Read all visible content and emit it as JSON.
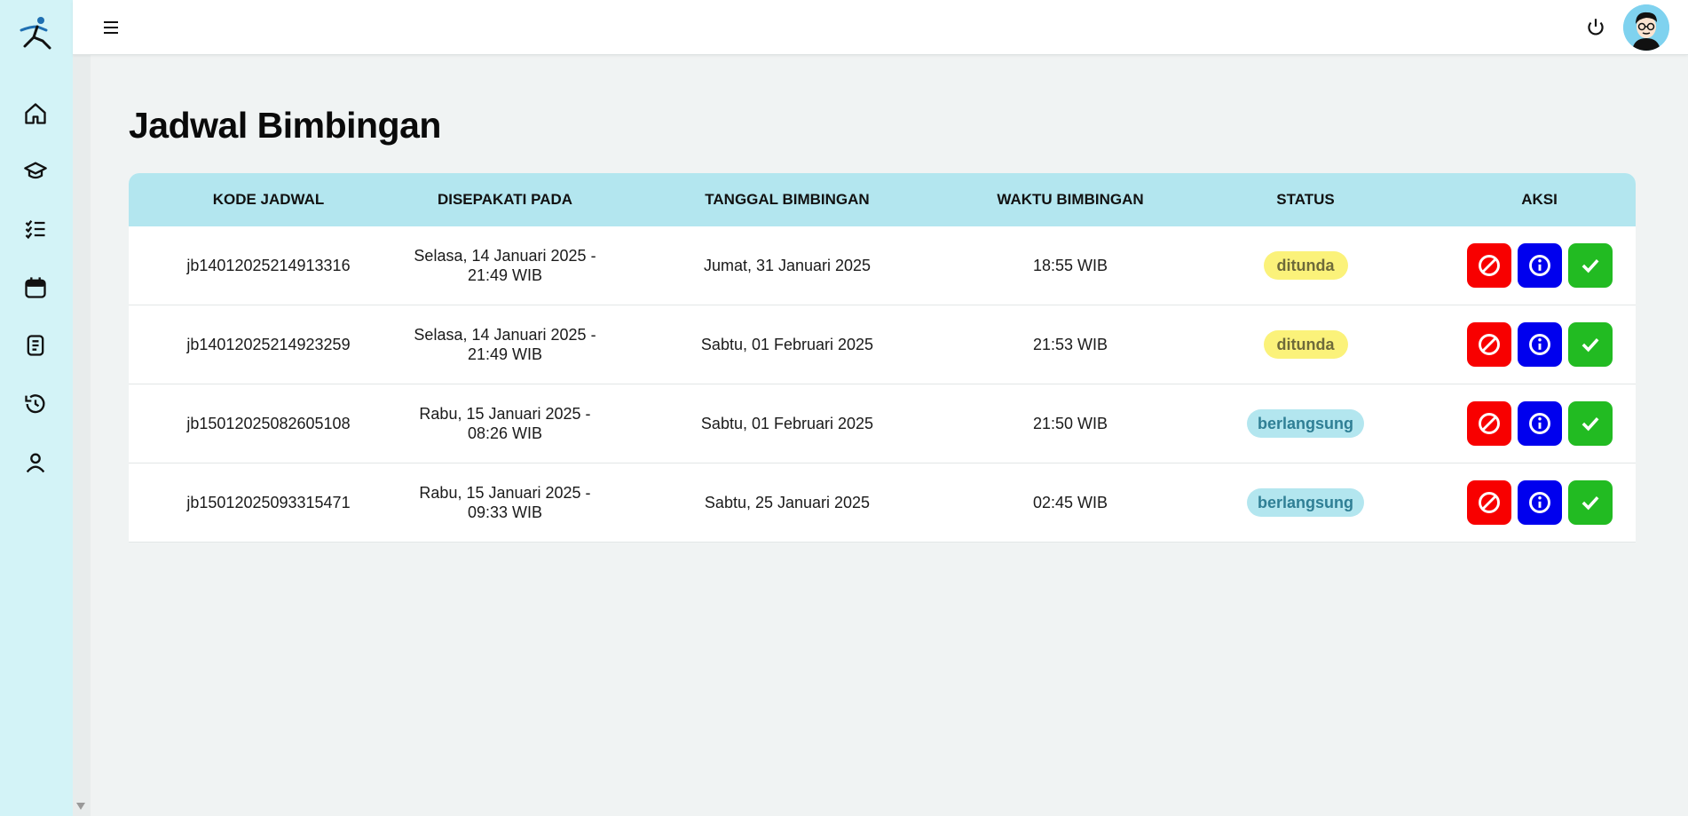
{
  "page": {
    "title": "Jadwal Bimbingan"
  },
  "table": {
    "headers": [
      "KODE JADWAL",
      "DISEPAKATI PADA",
      "TANGGAL BIMBINGAN",
      "WAKTU BIMBINGAN",
      "STATUS",
      "AKSI"
    ],
    "rows": [
      {
        "kode": "jb14012025214913316",
        "disepakati": "Selasa, 14 Januari 2025 - 21:49 WIB",
        "tanggal": "Jumat, 31 Januari 2025",
        "waktu": "18:55 WIB",
        "status": "ditunda"
      },
      {
        "kode": "jb14012025214923259",
        "disepakati": "Selasa, 14 Januari 2025 - 21:49 WIB",
        "tanggal": "Sabtu, 01 Februari 2025",
        "waktu": "21:53 WIB",
        "status": "ditunda"
      },
      {
        "kode": "jb15012025082605108",
        "disepakati": "Rabu, 15 Januari 2025 - 08:26 WIB",
        "tanggal": "Sabtu, 01 Februari 2025",
        "waktu": "21:50 WIB",
        "status": "berlangsung"
      },
      {
        "kode": "jb15012025093315471",
        "disepakati": "Rabu, 15 Januari 2025 - 09:33 WIB",
        "tanggal": "Sabtu, 25 Januari 2025",
        "waktu": "02:45 WIB",
        "status": "berlangsung"
      }
    ]
  },
  "sidebar": {
    "icons": [
      "home-icon",
      "graduation-cap-icon",
      "checklist-icon",
      "calendar-icon",
      "document-icon",
      "history-icon",
      "user-icon"
    ]
  },
  "topbar": {
    "icons": [
      "menu-icon",
      "power-icon",
      "avatar"
    ]
  },
  "colors": {
    "sidebar_bg": "#d3f3f7",
    "table_header_bg": "#b3e6ef",
    "badge_ditunda": "#fbf27a",
    "badge_berlangsung": "#b3e6ef",
    "btn_cancel": "#f80000",
    "btn_info": "#0000ee",
    "btn_approve": "#22bb22"
  },
  "row_actions": [
    "cancel-icon",
    "info-icon",
    "check-icon"
  ]
}
